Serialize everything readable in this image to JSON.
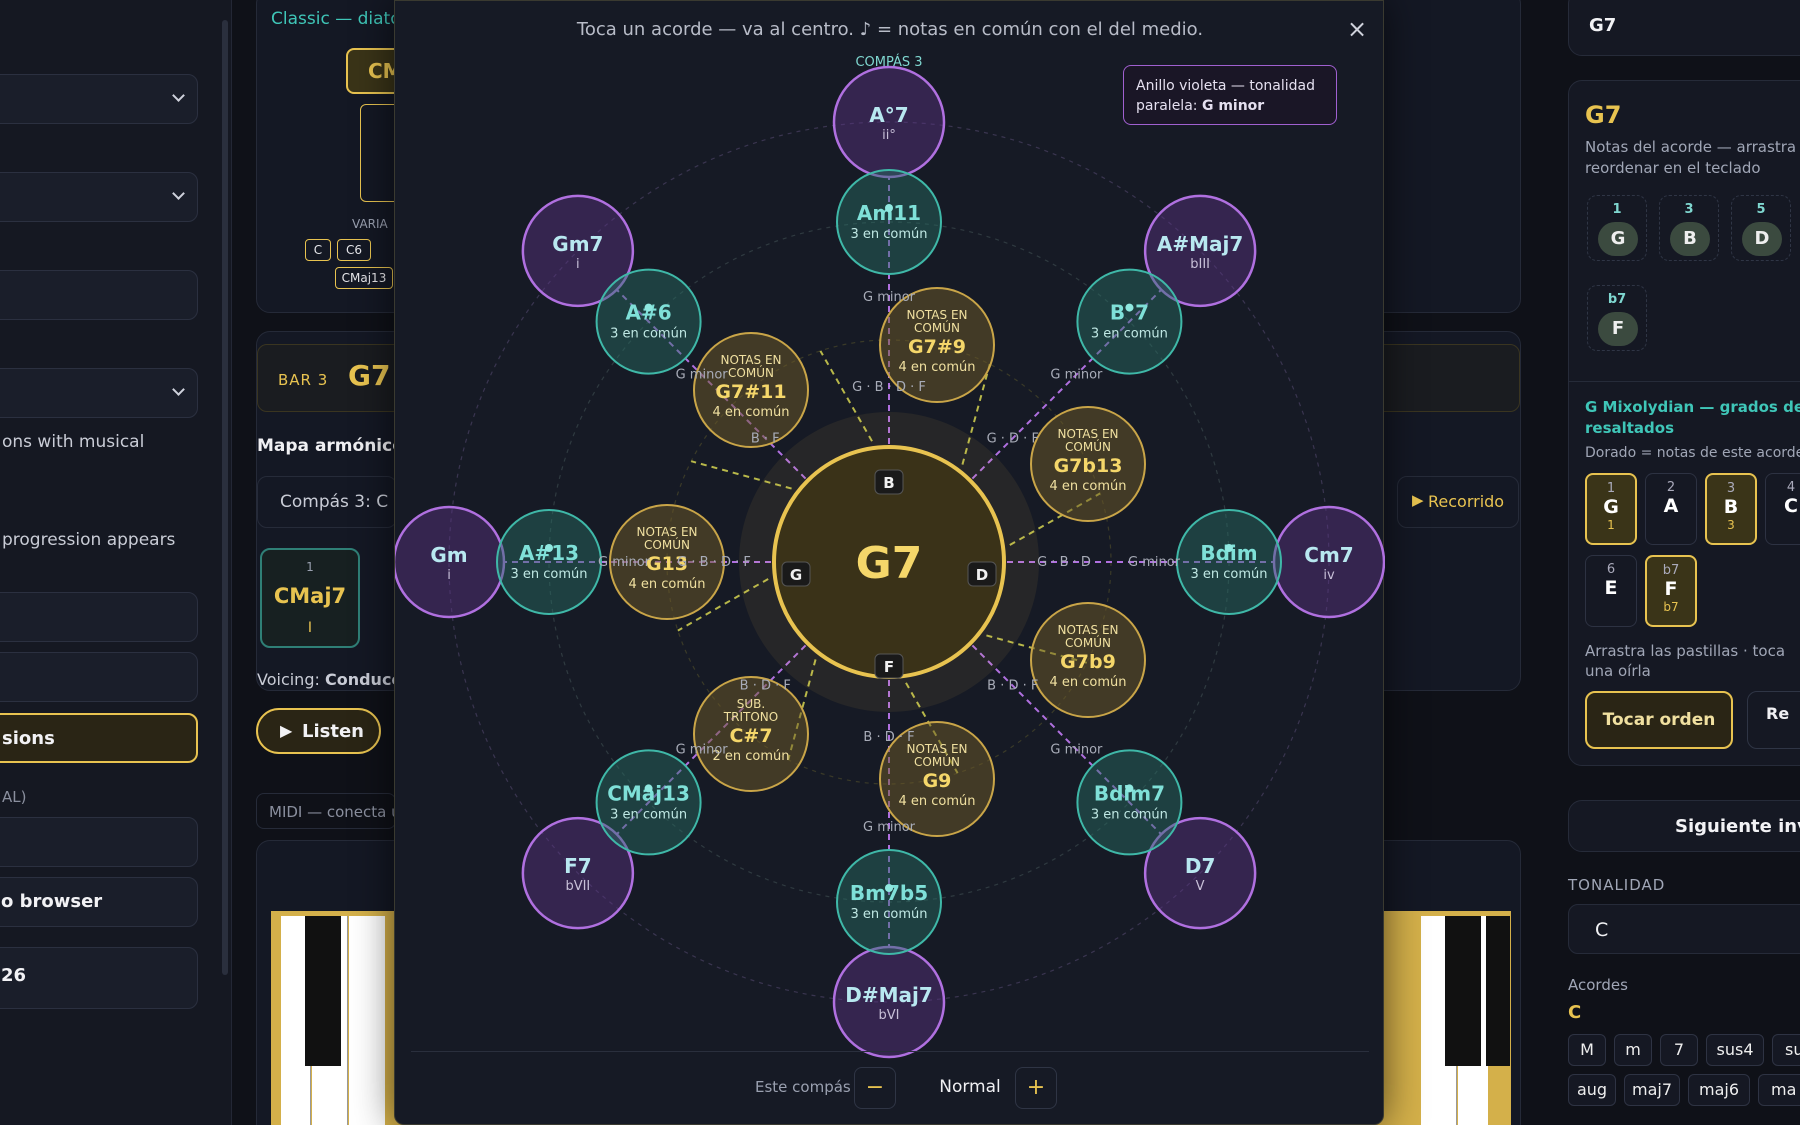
{
  "left": {
    "desc1": "ons with musical",
    "desc2": "progression appears",
    "active_button": "sions",
    "section_label": "AL)",
    "browser_label": "o browser",
    "number_label": "26"
  },
  "middle": {
    "top_title": "Classic — diato",
    "chord_chip": "CM",
    "variation_label": "VARIA",
    "variants": [
      "C",
      "C6",
      "C",
      "CMaj13"
    ],
    "bar_label": "BAR 3",
    "bar_chord": "G7",
    "harmonic_map_title": "Mapa armónico",
    "compas_row": "Compás 3: C",
    "recorrido_label": "Recorrido",
    "card_deg": "1",
    "card_chord": "CMaj7",
    "card_roman": "I",
    "voicing_prefix": "Voicing:",
    "voicing_value": "Conducc",
    "listen_label": "Listen",
    "midi_label": "MIDI — conecta u"
  },
  "modal": {
    "title": "Toca un acorde — va al centro. ♪ = notas en común con el del medio.",
    "close": "×",
    "violet_note_prefix": "Anillo violeta — tonalidad paralela: ",
    "violet_note_key": "G minor",
    "top_label": "COMPÁS 3",
    "center_chord": "G7",
    "center_notes": [
      {
        "name": "B",
        "pos": "top"
      },
      {
        "name": "G",
        "pos": "left"
      },
      {
        "name": "D",
        "pos": "right"
      },
      {
        "name": "F",
        "pos": "bottom"
      }
    ],
    "spokes": [
      {
        "angle": -90,
        "outer": "A°7",
        "outer_sub": "ii°",
        "mid": "Am11",
        "mid_sub": "3 en común",
        "inner": "G7#9",
        "inner_tag": "NOTAS EN COMÚN",
        "inner_sub": "4 en común",
        "l1": "G minor",
        "l2": "G · B · D · F",
        "l3": "G · B · D · F"
      },
      {
        "angle": -45,
        "outer": "A#Maj7",
        "outer_sub": "bIII",
        "mid": "B°7",
        "mid_sub": "3 en común",
        "inner": "G7b13",
        "inner_tag": "NOTAS EN COMÚN",
        "inner_sub": "4 en común",
        "l1": "G minor",
        "l2": "G · D · F",
        "l3": "G · B · D · F"
      },
      {
        "angle": 0,
        "outer": "Cm7",
        "outer_sub": "iv",
        "mid": "Bdim",
        "mid_sub": "3 en común",
        "inner": "G7b9",
        "inner_tag": "NOTAS EN COMÚN",
        "inner_sub": "4 en común",
        "l1": "G minor",
        "l2": "G · B · D",
        "l3": "G · B · D · F"
      },
      {
        "angle": 45,
        "outer": "D7",
        "outer_sub": "V",
        "mid": "Bdim7",
        "mid_sub": "3 en común",
        "inner": "G9",
        "inner_tag": "NOTAS EN COMÚN",
        "inner_sub": "4 en común",
        "l1": "G minor",
        "l2": "B · D · F",
        "l3": "G · B · D · F"
      },
      {
        "angle": 90,
        "outer": "D#Maj7",
        "outer_sub": "bVI",
        "mid": "Bm7b5",
        "mid_sub": "3 en común",
        "inner": "G9",
        "inner_tag": "",
        "inner_sub": "",
        "l1": "G minor",
        "l2": "B · D · F",
        "l3": ""
      },
      {
        "angle": 135,
        "outer": "F7",
        "outer_sub": "bVII",
        "mid": "CMaj13",
        "mid_sub": "3 en común",
        "inner": "C#7",
        "inner_tag": "SUB. TRITONO",
        "inner_sub": "2 en común",
        "l1": "G minor",
        "l2": "B · D · F",
        "l3": "G · B · D · F"
      },
      {
        "angle": 180,
        "outer": "Gm",
        "outer_sub": "i",
        "mid": "A#13",
        "mid_sub": "3 en común",
        "inner": "G13",
        "inner_tag": "NOTAS EN COMÚN",
        "inner_sub": "4 en común",
        "l1": "G minor",
        "l2": "G · B · D · F",
        "l3": "G · B · D · F"
      },
      {
        "angle": -135,
        "outer": "Gm7",
        "outer_sub": "i",
        "mid": "A#6",
        "mid_sub": "3 en común",
        "inner": "G7#11",
        "inner_tag": "NOTAS EN COMÚN",
        "inner_sub": "4 en común",
        "l1": "G minor",
        "l2": "B · F",
        "l3": "G · B · D · F"
      }
    ],
    "este_compas": "Este compás",
    "minus": "−",
    "speed": "Normal",
    "plus": "+"
  },
  "right": {
    "chord_field": "G7",
    "chord_title": "G7",
    "notes_help": "Notas del acorde — arrastra reordenar en el teclado",
    "notes": [
      {
        "deg": "1",
        "name": "G"
      },
      {
        "deg": "3",
        "name": "B"
      },
      {
        "deg": "5",
        "name": "D"
      },
      {
        "deg": "b7",
        "name": "F"
      }
    ],
    "mode_title": "G Mixolydian — grados del resaltados",
    "mode_help": "Dorado = notas de este acorde",
    "degrees": [
      {
        "a": "1",
        "b": "G",
        "c": "1",
        "on": true
      },
      {
        "a": "2",
        "b": "A",
        "c": "",
        "on": false
      },
      {
        "a": "3",
        "b": "B",
        "c": "3",
        "on": true
      },
      {
        "a": "4",
        "b": "C",
        "c": "",
        "on": false
      },
      {
        "a": "6",
        "b": "E",
        "c": "",
        "on": false
      },
      {
        "a": "b7",
        "b": "F",
        "c": "b7",
        "on": true
      }
    ],
    "drag_help": "Arrastra las pastillas · toca una oírla",
    "play_order": "Tocar orden",
    "re_label": "Re",
    "next_inversion": "Siguiente inv",
    "key_label": "TONALIDAD",
    "key_value": "C",
    "chords_label": "Acordes",
    "chords_root": "C",
    "chord_types_1": [
      "M",
      "m",
      "7",
      "sus4",
      "su"
    ],
    "chord_types_2": [
      "aug",
      "maj7",
      "maj6",
      "ma"
    ]
  },
  "colors": {
    "gold": "#e8c350",
    "teal": "#3fb8a8",
    "violet": "#b070e0",
    "bg": "#0f1118"
  }
}
